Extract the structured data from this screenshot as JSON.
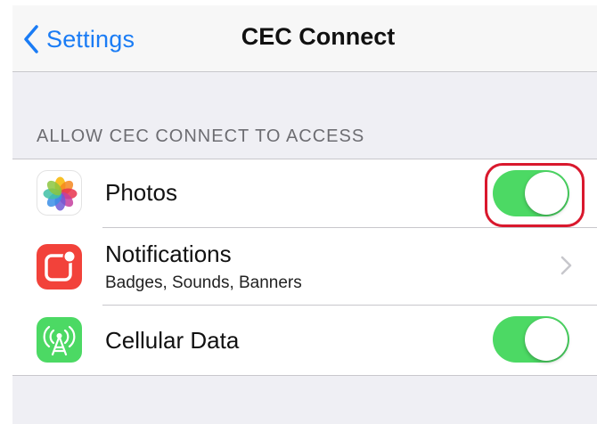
{
  "navbar": {
    "back_label": "Settings",
    "title": "CEC Connect",
    "accent_color": "#1a7cf5"
  },
  "section": {
    "header": "ALLOW CEC CONNECT TO ACCESS"
  },
  "rows": [
    {
      "icon": "photos-icon",
      "title": "Photos",
      "control": "toggle",
      "toggle_on": true,
      "highlighted": true,
      "highlight_color": "#d9182d"
    },
    {
      "icon": "notifications-icon",
      "title": "Notifications",
      "subtitle": "Badges, Sounds, Banners",
      "control": "chevron",
      "icon_color": "#f2423a"
    },
    {
      "icon": "cellular-data-icon",
      "title": "Cellular Data",
      "control": "toggle",
      "toggle_on": true,
      "icon_color": "#4cd964"
    }
  ],
  "colors": {
    "toggle_on": "#4cd964",
    "background": "#efeff4",
    "separator": "#c8c7cc"
  }
}
